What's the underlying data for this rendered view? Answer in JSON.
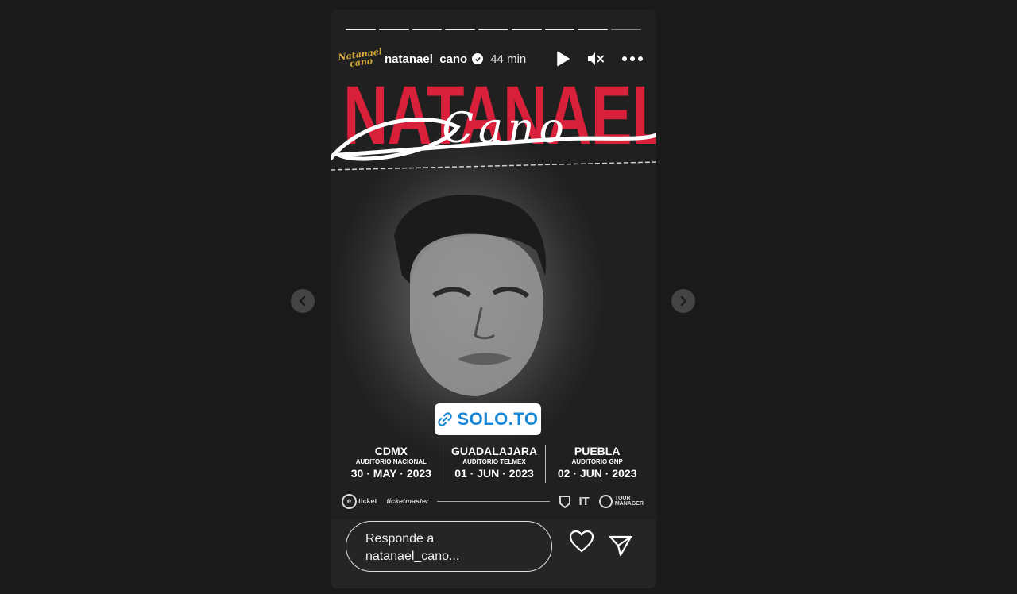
{
  "story": {
    "username": "natanael_cano",
    "time_ago": "44 min",
    "avatar_text_top": "Natanael",
    "avatar_text_bottom": "cano",
    "progress_segments": 9,
    "progress_current": 9
  },
  "poster": {
    "title_line_1": "NATANAEL",
    "title_line_2": "NATANAEL",
    "script_word": "Cano",
    "link_sticker": "SOLO.TO",
    "accent_color": "#d8203a",
    "link_color": "#1a87d6",
    "venues": [
      {
        "city": "CDMX",
        "place": "AUDITORIO NACIONAL",
        "date": "30 · MAY · 2023"
      },
      {
        "city": "GUADALAJARA",
        "place": "AUDITORIO TELMEX",
        "date": "01 · JUN · 2023"
      },
      {
        "city": "PUEBLA",
        "place": "AUDITORIO GNP",
        "date": "02 · JUN · 2023"
      }
    ],
    "sponsors": {
      "eticket": "ticket",
      "ticketmaster": "ticketmaster",
      "it": "IT",
      "tour_manager_1": "TOUR",
      "tour_manager_2": "MANAGER"
    }
  },
  "footer": {
    "reply_placeholder_line1": "Responde a",
    "reply_placeholder_line2": "natanael_cano..."
  },
  "icons": {
    "verified": "verified-badge-icon",
    "play": "play-icon",
    "mute": "speaker-muted-icon",
    "more": "more-options-icon",
    "like": "heart-icon",
    "share": "paper-plane-icon",
    "prev": "chevron-left-icon",
    "next": "chevron-right-icon",
    "link": "link-icon"
  }
}
